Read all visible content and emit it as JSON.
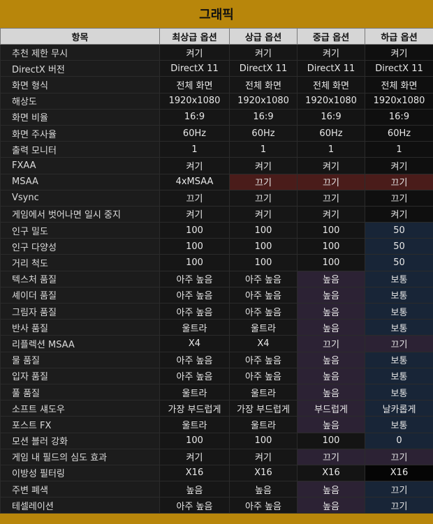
{
  "title": "그래픽",
  "headers": [
    "항목",
    "최상급 옵션",
    "상급 옵션",
    "중급 옵션",
    "하급 옵션"
  ],
  "rows": [
    {
      "label": "추천 제한 무시",
      "values": [
        "켜기",
        "켜기",
        "켜기",
        "켜기"
      ]
    },
    {
      "label": "DirectX 버전",
      "values": [
        "DirectX 11",
        "DirectX 11",
        "DirectX 11",
        "DirectX 11"
      ]
    },
    {
      "label": "화면 형식",
      "values": [
        "전체 화면",
        "전체 화면",
        "전체 화면",
        "전체 화면"
      ]
    },
    {
      "label": "해상도",
      "values": [
        "1920x1080",
        "1920x1080",
        "1920x1080",
        "1920x1080"
      ]
    },
    {
      "label": "화면 비율",
      "values": [
        "16:9",
        "16:9",
        "16:9",
        "16:9"
      ]
    },
    {
      "label": "화면 주사율",
      "values": [
        "60Hz",
        "60Hz",
        "60Hz",
        "60Hz"
      ]
    },
    {
      "label": "출력 모니터",
      "values": [
        "1",
        "1",
        "1",
        "1"
      ]
    },
    {
      "label": "FXAA",
      "values": [
        "켜기",
        "켜기",
        "켜기",
        "켜기"
      ]
    },
    {
      "label": "MSAA",
      "values": [
        "4xMSAA",
        "끄기",
        "끄기",
        "끄기"
      ]
    },
    {
      "label": "Vsync",
      "values": [
        "끄기",
        "끄기",
        "끄기",
        "끄기"
      ]
    },
    {
      "label": "게임에서 벗어나면 일시 중지",
      "values": [
        "켜기",
        "켜기",
        "켜기",
        "켜기"
      ]
    },
    {
      "label": "인구 밀도",
      "values": [
        "100",
        "100",
        "100",
        "50"
      ]
    },
    {
      "label": "인구 다양성",
      "values": [
        "100",
        "100",
        "100",
        "50"
      ]
    },
    {
      "label": "거리 척도",
      "values": [
        "100",
        "100",
        "100",
        "50"
      ]
    },
    {
      "label": "텍스처 품질",
      "values": [
        "아주 높음",
        "아주 높음",
        "높음",
        "보통"
      ]
    },
    {
      "label": "셰이더 품질",
      "values": [
        "아주 높음",
        "아주 높음",
        "높음",
        "보통"
      ]
    },
    {
      "label": "그림자 품질",
      "values": [
        "아주 높음",
        "아주 높음",
        "높음",
        "보통"
      ]
    },
    {
      "label": "반사 품질",
      "values": [
        "울트라",
        "울트라",
        "높음",
        "보통"
      ]
    },
    {
      "label": "리플렉션 MSAA",
      "values": [
        "X4",
        "X4",
        "끄기",
        "끄기"
      ]
    },
    {
      "label": "물 품질",
      "values": [
        "아주 높음",
        "아주 높음",
        "높음",
        "보통"
      ]
    },
    {
      "label": "입자 품질",
      "values": [
        "아주 높음",
        "아주 높음",
        "높음",
        "보통"
      ]
    },
    {
      "label": "풀 품질",
      "values": [
        "울트라",
        "울트라",
        "높음",
        "보통"
      ]
    },
    {
      "label": "소프트 섀도우",
      "values": [
        "가장 부드럽게",
        "가장 부드럽게",
        "부드럽게",
        "날카롭게"
      ]
    },
    {
      "label": "포스트 FX",
      "values": [
        "울트라",
        "울트라",
        "높음",
        "보통"
      ]
    },
    {
      "label": "모션 블러 강화",
      "values": [
        "100",
        "100",
        "100",
        "0"
      ]
    },
    {
      "label": "게임 내 필드의 심도 효과",
      "values": [
        "켜기",
        "켜기",
        "끄기",
        "끄기"
      ]
    },
    {
      "label": "이방성 필터링",
      "values": [
        "X16",
        "X16",
        "X16",
        "X16"
      ]
    },
    {
      "label": "주변 폐색",
      "values": [
        "높음",
        "높음",
        "높음",
        "끄기"
      ]
    },
    {
      "label": "테셀레이션",
      "values": [
        "아주 높음",
        "아주 높음",
        "높음",
        "끄기"
      ]
    }
  ],
  "cell_styles": [
    [
      "",
      "",
      "",
      "c4"
    ],
    [
      "",
      "",
      "",
      "c4"
    ],
    [
      "",
      "",
      "",
      "c4"
    ],
    [
      "",
      "",
      "",
      "c4"
    ],
    [
      "",
      "",
      "",
      "c4"
    ],
    [
      "",
      "",
      "",
      "c4"
    ],
    [
      "",
      "",
      "",
      "c4"
    ],
    [
      "",
      "",
      "",
      "c4"
    ],
    [
      "",
      "red",
      "red",
      "red"
    ],
    [
      "",
      "",
      "",
      "c4"
    ],
    [
      "",
      "",
      "",
      "c4"
    ],
    [
      "",
      "",
      "",
      "blue"
    ],
    [
      "",
      "",
      "",
      "blue"
    ],
    [
      "",
      "",
      "",
      "blue"
    ],
    [
      "",
      "",
      "purple",
      "blue"
    ],
    [
      "",
      "",
      "purple",
      "blue"
    ],
    [
      "",
      "",
      "purple",
      "blue"
    ],
    [
      "",
      "",
      "purple",
      "blue"
    ],
    [
      "",
      "",
      "purple",
      "purple"
    ],
    [
      "",
      "",
      "purple",
      "blue"
    ],
    [
      "",
      "",
      "purple",
      "blue"
    ],
    [
      "",
      "",
      "purple",
      "blue"
    ],
    [
      "",
      "",
      "purple",
      "blue"
    ],
    [
      "",
      "",
      "purple",
      "blue"
    ],
    [
      "",
      "",
      "",
      "blue"
    ],
    [
      "",
      "",
      "purple",
      "purple"
    ],
    [
      "",
      "",
      "",
      "black"
    ],
    [
      "",
      "",
      "purple",
      "blue"
    ],
    [
      "",
      "",
      "purple",
      "blue"
    ]
  ],
  "colors": {
    "gold": "#b8860b",
    "header_bg": "#d6d6d6",
    "red_cell": "#4a1c1a",
    "purple_cell": "#2c2234",
    "blue_cell": "#182537"
  }
}
